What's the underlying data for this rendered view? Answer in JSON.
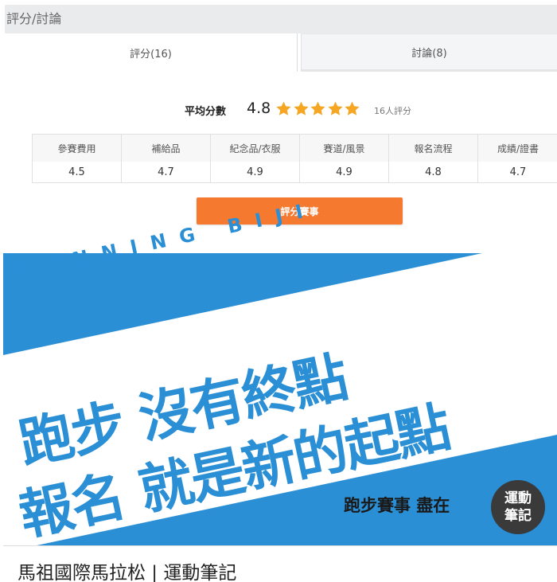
{
  "section": {
    "title": "評分/討論"
  },
  "tabs": [
    {
      "label": "評分(16)",
      "active": true
    },
    {
      "label": "討論(8)",
      "active": false
    }
  ],
  "summary": {
    "avg_label": "平均分數",
    "avg_score": "4.8",
    "stars": 5,
    "star_color": "#f5a623",
    "count": "16人評分"
  },
  "ratings": [
    {
      "label": "參賽費用",
      "value": "4.5"
    },
    {
      "label": "補給品",
      "value": "4.7"
    },
    {
      "label": "紀念品/衣服",
      "value": "4.9"
    },
    {
      "label": "賽道/風景",
      "value": "4.9"
    },
    {
      "label": "報名流程",
      "value": "4.8"
    },
    {
      "label": "成績/證書",
      "value": "4.7"
    }
  ],
  "rate_button": {
    "label": "評分賽事",
    "color": "#f57a30"
  },
  "banner": {
    "brand": "RUNNING BIJI",
    "headline_line1": "跑步 沒有終點",
    "headline_line2": "報名 就是新的起點",
    "tagline": "跑步賽事 盡在",
    "logo_line1": "運動",
    "logo_line2": "筆記",
    "colors": {
      "blue": "#2b8fd6",
      "white": "#ffffff"
    }
  },
  "caption": "馬祖國際馬拉松 | 運動筆記"
}
